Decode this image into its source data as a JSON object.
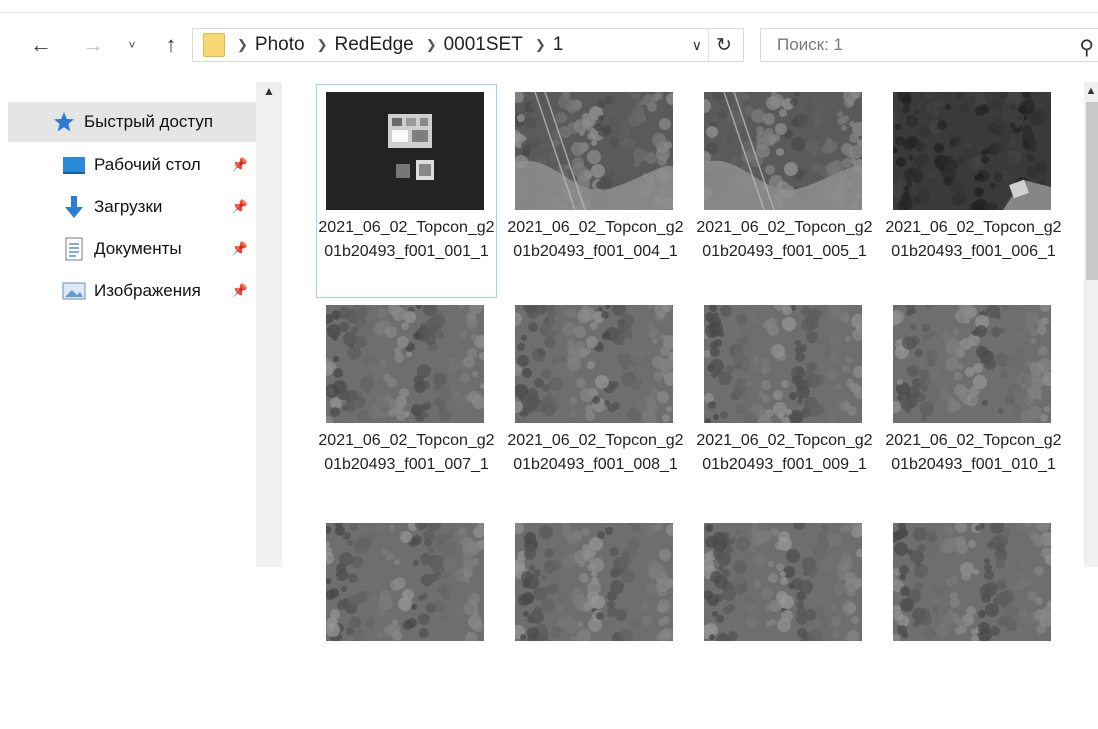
{
  "nav": {
    "back_icon": "arrow-left-icon",
    "forward_icon": "arrow-right-icon",
    "recent_icon": "chevron-down-icon",
    "up_icon": "arrow-up-icon"
  },
  "address": {
    "folder_icon": "folder-icon",
    "crumbs": [
      "Photo",
      "RedEdge",
      "0001SET",
      "1"
    ]
  },
  "search": {
    "placeholder": "Поиск: 1",
    "icon": "search-icon"
  },
  "sidebar": {
    "items": [
      {
        "label": "Быстрый доступ",
        "icon": "star-icon",
        "color": "#2e7bd6"
      },
      {
        "label": "Рабочий стол",
        "icon": "desktop-icon",
        "color": "#2a8ad8"
      },
      {
        "label": "Загрузки",
        "icon": "download-icon",
        "color": "#2a7fd4"
      },
      {
        "label": "Документы",
        "icon": "document-icon",
        "color": "#8a8a8a"
      },
      {
        "label": "Изображения",
        "icon": "image-icon",
        "color": "#5d9cd6"
      }
    ]
  },
  "files": [
    {
      "name": "2021_06_02_Topcon_g201b20493_f001_001_1",
      "kind": "target"
    },
    {
      "name": "2021_06_02_Topcon_g201b20493_f001_004_1",
      "kind": "road"
    },
    {
      "name": "2021_06_02_Topcon_g201b20493_f001_005_1",
      "kind": "road"
    },
    {
      "name": "2021_06_02_Topcon_g201b20493_f001_006_1",
      "kind": "dark"
    },
    {
      "name": "2021_06_02_Topcon_g201b20493_f001_007_1",
      "kind": "forest"
    },
    {
      "name": "2021_06_02_Topcon_g201b20493_f001_008_1",
      "kind": "forest"
    },
    {
      "name": "2021_06_02_Topcon_g201b20493_f001_009_1",
      "kind": "forest"
    },
    {
      "name": "2021_06_02_Topcon_g201b20493_f001_010_1",
      "kind": "forest"
    },
    {
      "name": "",
      "kind": "forest"
    },
    {
      "name": "",
      "kind": "forest"
    },
    {
      "name": "",
      "kind": "forest"
    },
    {
      "name": "",
      "kind": "forest"
    }
  ]
}
